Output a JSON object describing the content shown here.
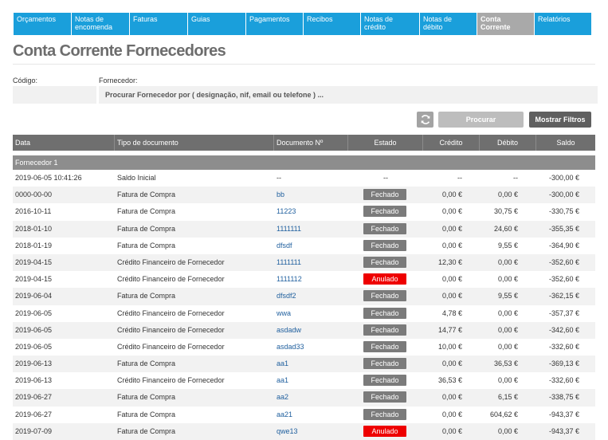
{
  "tabs": [
    {
      "label": "Orçamentos",
      "active": false
    },
    {
      "label": "Notas de encomenda",
      "active": false
    },
    {
      "label": "Faturas",
      "active": false
    },
    {
      "label": "Guias",
      "active": false
    },
    {
      "label": "Pagamentos",
      "active": false
    },
    {
      "label": "Recibos",
      "active": false
    },
    {
      "label": "Notas de crédito",
      "active": false
    },
    {
      "label": "Notas de débito",
      "active": false
    },
    {
      "label": "Conta Corrente",
      "active": true
    },
    {
      "label": "Relatórios",
      "active": false
    }
  ],
  "page_title": "Conta Corrente Fornecedores",
  "form": {
    "codigo_label": "Código:",
    "fornecedor_label": "Fornecedor:",
    "fornecedor_placeholder": "Procurar Fornecedor por ( designação, nif, email ou telefone ) ..."
  },
  "buttons": {
    "refresh_icon": "refresh-icon",
    "search_label": "Procurar",
    "filters_label": "Mostrar Filtros"
  },
  "table": {
    "headers": {
      "data": "Data",
      "tipo": "Tipo de documento",
      "documento": "Documento Nº",
      "estado": "Estado",
      "credito": "Crédito",
      "debito": "Débito",
      "saldo": "Saldo"
    },
    "group": "Fornecedor 1",
    "rows": [
      {
        "data": "2019-06-05 10:41:26",
        "tipo": "Saldo Inicial",
        "doc": "--",
        "estado": "--",
        "status": "",
        "credito": "--",
        "debito": "--",
        "saldo": "-300,00 €"
      },
      {
        "data": "0000-00-00",
        "tipo": "Fatura de Compra",
        "doc": "bb",
        "estado": "Fechado",
        "status": "fechado",
        "credito": "0,00 €",
        "debito": "0,00 €",
        "saldo": "-300,00 €"
      },
      {
        "data": "2016-10-11",
        "tipo": "Fatura de Compra",
        "doc": "11223",
        "estado": "Fechado",
        "status": "fechado",
        "credito": "0,00 €",
        "debito": "30,75 €",
        "saldo": "-330,75 €"
      },
      {
        "data": "2018-01-10",
        "tipo": "Fatura de Compra",
        "doc": "1111111",
        "estado": "Fechado",
        "status": "fechado",
        "credito": "0,00 €",
        "debito": "24,60 €",
        "saldo": "-355,35 €"
      },
      {
        "data": "2018-01-19",
        "tipo": "Fatura de Compra",
        "doc": "dfsdf",
        "estado": "Fechado",
        "status": "fechado",
        "credito": "0,00 €",
        "debito": "9,55 €",
        "saldo": "-364,90 €"
      },
      {
        "data": "2019-04-15",
        "tipo": "Crédito Financeiro de Fornecedor",
        "doc": "1111111",
        "estado": "Fechado",
        "status": "fechado",
        "credito": "12,30 €",
        "debito": "0,00 €",
        "saldo": "-352,60 €"
      },
      {
        "data": "2019-04-15",
        "tipo": "Crédito Financeiro de Fornecedor",
        "doc": "1111112",
        "estado": "Anulado",
        "status": "anulado",
        "credito": "0,00 €",
        "debito": "0,00 €",
        "saldo": "-352,60 €"
      },
      {
        "data": "2019-06-04",
        "tipo": "Fatura de Compra",
        "doc": "dfsdf2",
        "estado": "Fechado",
        "status": "fechado",
        "credito": "0,00 €",
        "debito": "9,55 €",
        "saldo": "-362,15 €"
      },
      {
        "data": "2019-06-05",
        "tipo": "Crédito Financeiro de Fornecedor",
        "doc": "wwa",
        "estado": "Fechado",
        "status": "fechado",
        "credito": "4,78 €",
        "debito": "0,00 €",
        "saldo": "-357,37 €"
      },
      {
        "data": "2019-06-05",
        "tipo": "Crédito Financeiro de Fornecedor",
        "doc": "asdadw",
        "estado": "Fechado",
        "status": "fechado",
        "credito": "14,77 €",
        "debito": "0,00 €",
        "saldo": "-342,60 €"
      },
      {
        "data": "2019-06-05",
        "tipo": "Crédito Financeiro de Fornecedor",
        "doc": "asdad33",
        "estado": "Fechado",
        "status": "fechado",
        "credito": "10,00 €",
        "debito": "0,00 €",
        "saldo": "-332,60 €"
      },
      {
        "data": "2019-06-13",
        "tipo": "Fatura de Compra",
        "doc": "aa1",
        "estado": "Fechado",
        "status": "fechado",
        "credito": "0,00 €",
        "debito": "36,53 €",
        "saldo": "-369,13 €"
      },
      {
        "data": "2019-06-13",
        "tipo": "Crédito Financeiro de Fornecedor",
        "doc": "aa1",
        "estado": "Fechado",
        "status": "fechado",
        "credito": "36,53 €",
        "debito": "0,00 €",
        "saldo": "-332,60 €"
      },
      {
        "data": "2019-06-27",
        "tipo": "Fatura de Compra",
        "doc": "aa2",
        "estado": "Fechado",
        "status": "fechado",
        "credito": "0,00 €",
        "debito": "6,15 €",
        "saldo": "-338,75 €"
      },
      {
        "data": "2019-06-27",
        "tipo": "Fatura de Compra",
        "doc": "aa21",
        "estado": "Fechado",
        "status": "fechado",
        "credito": "0,00 €",
        "debito": "604,62 €",
        "saldo": "-943,37 €"
      },
      {
        "data": "2019-07-09",
        "tipo": "Fatura de Compra",
        "doc": "qwe13",
        "estado": "Anulado",
        "status": "anulado",
        "credito": "0,00 €",
        "debito": "0,00 €",
        "saldo": "-943,37 €"
      }
    ]
  },
  "colors": {
    "tab_blue": "#1a9fdb",
    "tab_active": "#a9a9a9",
    "anulado": "#ee0000",
    "fechado": "#7b7b7b",
    "link": "#1f5f9e"
  }
}
